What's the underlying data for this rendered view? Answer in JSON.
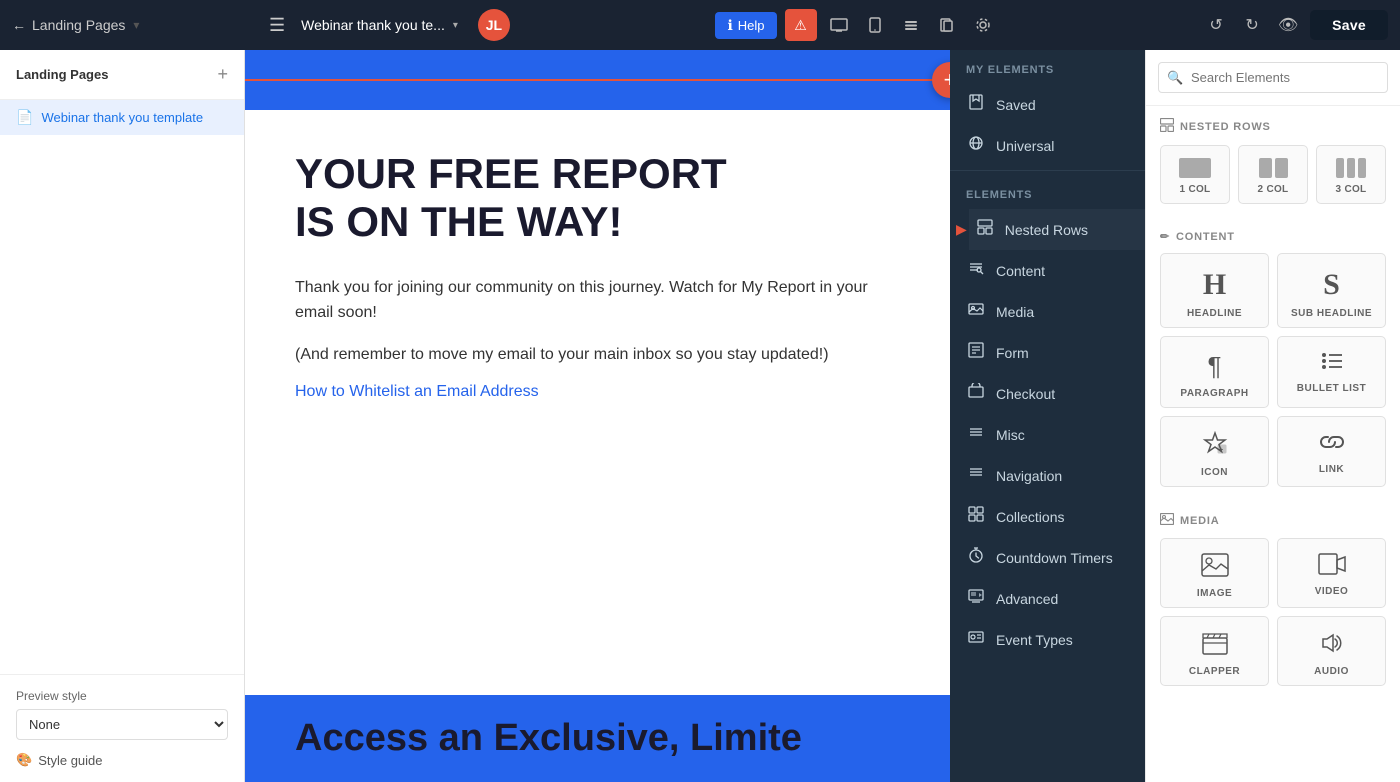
{
  "topbar": {
    "back_label": "Pages",
    "page_title": "Webinar thank you te...",
    "hamburger_icon": "☰",
    "avatar_initials": "JL",
    "help_label": "Help",
    "help_icon": "?",
    "undo_icon": "↺",
    "redo_icon": "↻",
    "preview_icon": "👁",
    "save_label": "Save",
    "toolbar_icons": [
      "□",
      "⊞",
      "⊡",
      "⊗",
      "◎"
    ]
  },
  "sidebar": {
    "section_title": "Landing Pages",
    "add_icon": "+",
    "items": [
      {
        "label": "Webinar thank you template",
        "icon": "📄",
        "active": true
      }
    ],
    "preview_style": {
      "label": "Preview style",
      "placeholder": "None",
      "options": [
        "None"
      ]
    },
    "style_guide_label": "Style guide",
    "style_guide_icon": "🎨"
  },
  "canvas": {
    "headline": "YOUR FREE REPORT\nIS ON THE WAY!",
    "body1": "Thank you for joining our community on this journey. Watch for My Report in your email soon!",
    "body2": "(And remember to move my email to your main inbox so you stay updated!)",
    "link_text": "How to Whitelist an Email Address",
    "bottom_text": "Access an Exclusive, Limite",
    "plus_button": "+"
  },
  "elements_panel": {
    "my_elements_title": "MY ELEMENTS",
    "items_my": [
      {
        "label": "Saved",
        "icon": "💾"
      },
      {
        "label": "Universal",
        "icon": "🌐"
      }
    ],
    "elements_title": "ELEMENTS",
    "items_elements": [
      {
        "label": "Nested Rows",
        "icon": "⊞",
        "active": true
      },
      {
        "label": "Content",
        "icon": "✏️"
      },
      {
        "label": "Media",
        "icon": "🖼"
      },
      {
        "label": "Form",
        "icon": "☰"
      },
      {
        "label": "Checkout",
        "icon": "🛒"
      },
      {
        "label": "Misc",
        "icon": "≡"
      },
      {
        "label": "Navigation",
        "icon": "≡"
      },
      {
        "label": "Collections",
        "icon": "⊞"
      },
      {
        "label": "Countdown Timers",
        "icon": "⏱"
      },
      {
        "label": "Advanced",
        "icon": "🎥"
      },
      {
        "label": "Event Types",
        "icon": "🖼"
      }
    ]
  },
  "catalog": {
    "search_placeholder": "Search Elements",
    "nested_rows_title": "NESTED ROWS",
    "nested_rows_icon": "⊞",
    "nested_items": [
      {
        "label": "1 COL"
      },
      {
        "label": "2 COL"
      },
      {
        "label": "3 COL"
      }
    ],
    "content_title": "CONTENT",
    "content_icon": "✏",
    "content_items": [
      {
        "label": "HEADLINE",
        "icon_type": "H"
      },
      {
        "label": "SUB HEADLINE",
        "icon_type": "S"
      },
      {
        "label": "PARAGRAPH",
        "icon_type": "para"
      },
      {
        "label": "BULLET LIST",
        "icon_type": "list"
      },
      {
        "label": "ICON",
        "icon_type": "icon_grid"
      },
      {
        "label": "LINK",
        "icon_type": "link"
      }
    ],
    "media_title": "MEDIA",
    "media_icon": "🖼",
    "media_items": [
      {
        "label": "IMAGE",
        "icon_type": "image"
      },
      {
        "label": "VIDEO",
        "icon_type": "video"
      },
      {
        "label": "CLAPPER",
        "icon_type": "clapper"
      },
      {
        "label": "AUDIO",
        "icon_type": "audio"
      }
    ]
  }
}
